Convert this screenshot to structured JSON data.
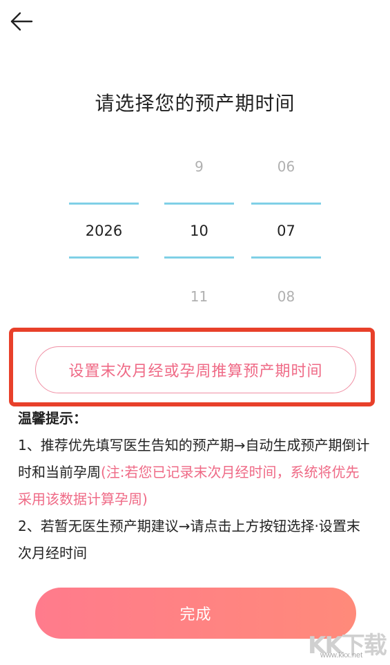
{
  "header": {
    "back_icon": "arrow-left-icon"
  },
  "title": "请选择您的预产期时间",
  "picker": {
    "year": {
      "prev": "",
      "selected": "2026",
      "next": ""
    },
    "month": {
      "prev": "9",
      "selected": "10",
      "next": "11"
    },
    "day": {
      "prev": "06",
      "selected": "07",
      "next": "08"
    },
    "line_color": "#7fd0e6"
  },
  "calc_button": {
    "label": "设置末次月经或孕周推算预产期时间",
    "highlight_color": "#e8402a"
  },
  "tips": {
    "title": "温馨提示：",
    "line1_a": "1、推荐优先填写医生告知的预产期→自动生成预产期倒计时和当前孕周",
    "line1_note": "(注:若您已记录末次月经时间，系统将优先采用该数据计算孕周)",
    "line2": "2、若暂无医生预产期建议→请点击上方按钮选择·设置末次月经时间"
  },
  "done_button": {
    "label": "完成"
  },
  "watermark": {
    "logo": "KK下载",
    "url": "www.kkx.net"
  },
  "colors": {
    "accent_pink": "#ef6a86",
    "done_gradient_start": "#ff7b8c",
    "done_gradient_end": "#ff8a7a"
  }
}
